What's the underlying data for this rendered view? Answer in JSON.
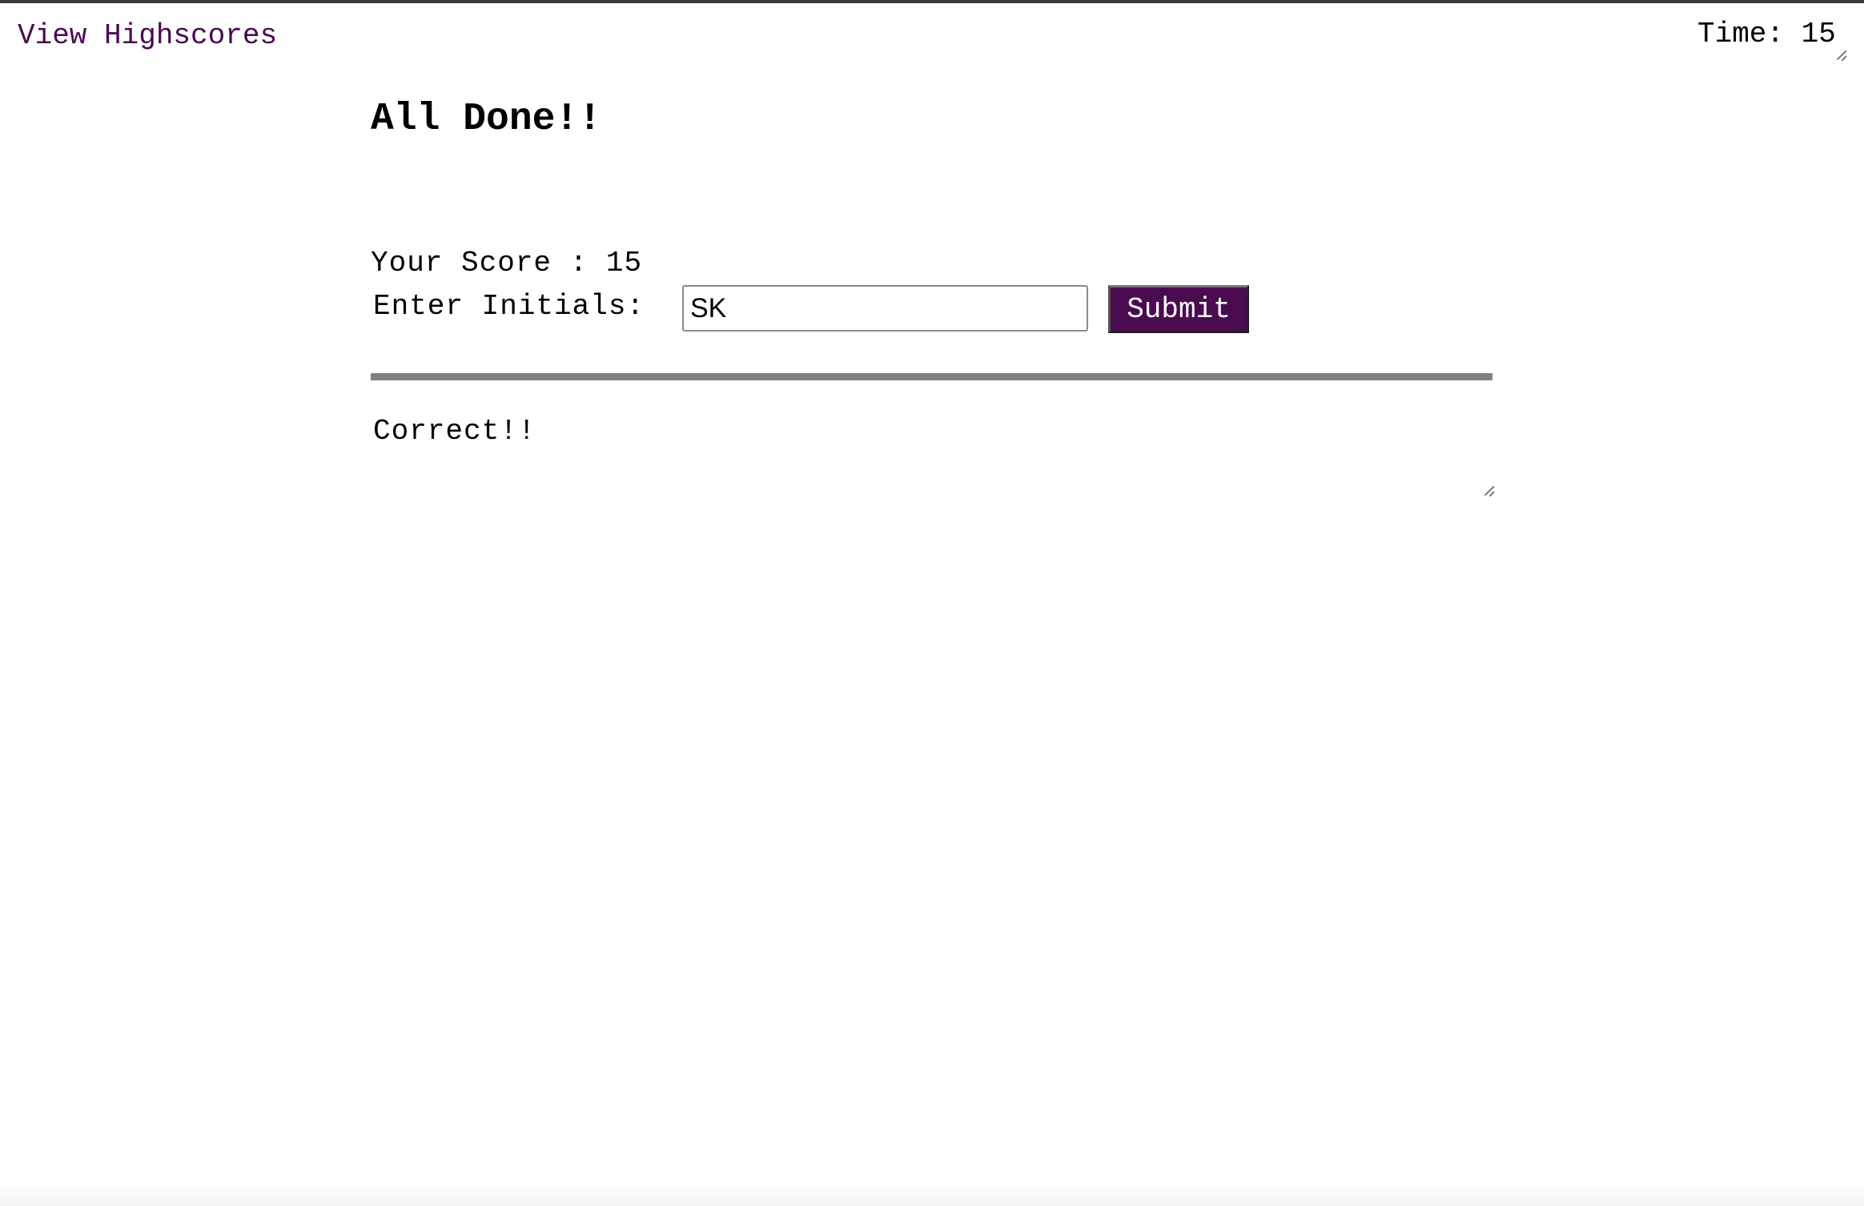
{
  "header": {
    "highscores_link": "View Highscores",
    "timer_label": "Time: ",
    "timer_value": "15"
  },
  "main": {
    "title": "All Done!!",
    "score_text": "Your Score : 15",
    "initials_label": "Enter Initials: ",
    "initials_value": "SK",
    "submit_label": "Submit",
    "feedback": "Correct!!"
  },
  "colors": {
    "accent": "#4b0b50",
    "divider": "#808080"
  }
}
